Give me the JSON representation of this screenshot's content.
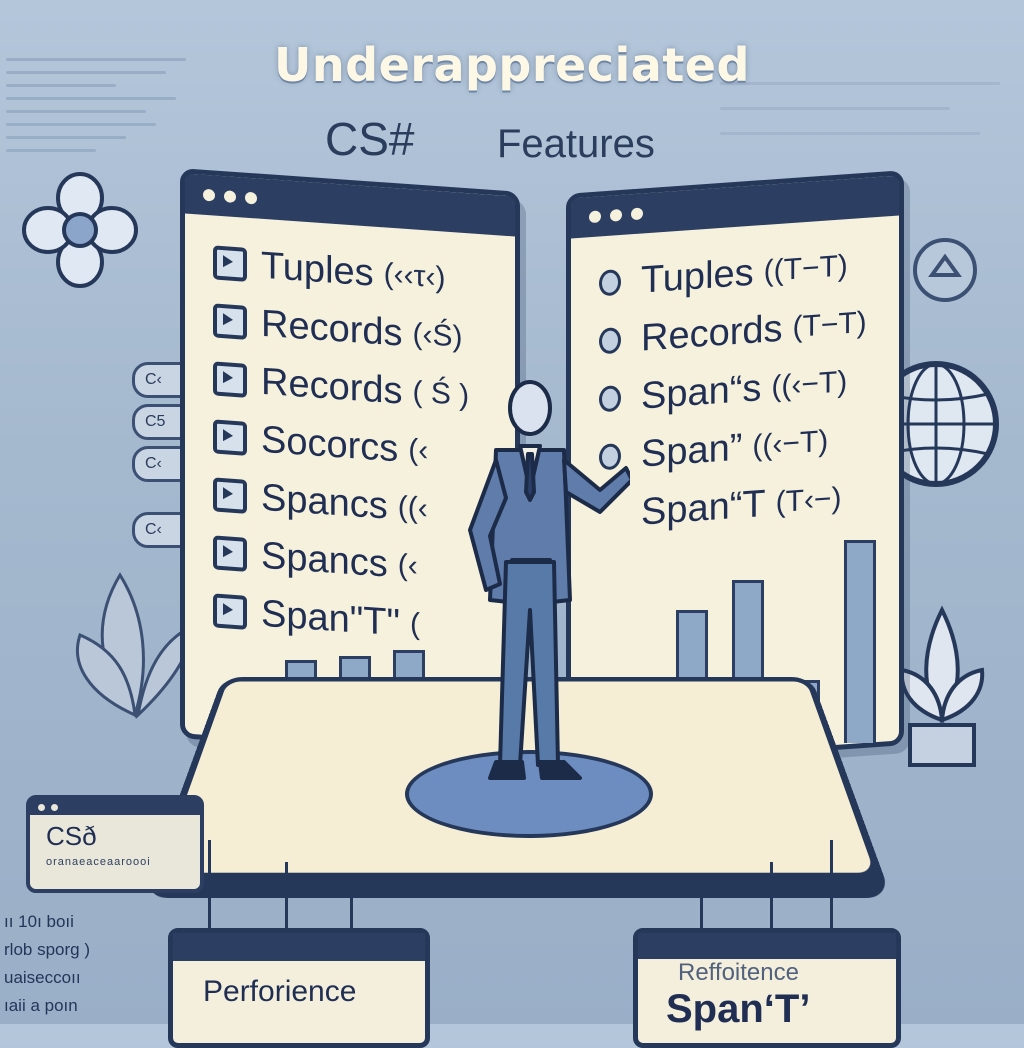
{
  "title": "Underappreciated",
  "subtitle": {
    "left": "CS#",
    "right": "Features"
  },
  "left_window": {
    "items": [
      {
        "label": "Tuples",
        "suffix": "(‹‹τ‹)"
      },
      {
        "label": "Records",
        "suffix": "(‹Ś)"
      },
      {
        "label": "Records",
        "suffix": "( Ś )"
      },
      {
        "label": "Socorcs",
        "suffix": "(‹"
      },
      {
        "label": "Spancs",
        "suffix": "((‹"
      },
      {
        "label": "Spancs",
        "suffix": "(‹"
      },
      {
        "label": "Span\"T\"",
        "suffix": "("
      }
    ]
  },
  "right_window": {
    "items": [
      {
        "label": "Tuples",
        "suffix": "((T−T)"
      },
      {
        "label": "Records",
        "suffix": "(T−T)"
      },
      {
        "label": "Span“s",
        "suffix": "((‹−T)"
      },
      {
        "label": "Span”",
        "suffix": "((‹−T)"
      },
      {
        "label": "Span“T",
        "suffix": "(T‹−)"
      }
    ]
  },
  "side_pills": [
    "C‹",
    "C5",
    "C‹",
    "C‹"
  ],
  "cards": {
    "cs": {
      "title": "CSð",
      "subtext": "oranaeaceaaroooi"
    },
    "performance": "Perforience",
    "span": {
      "top": "Reffoitence",
      "main": "Span‘T’"
    }
  },
  "bottom_left_text": [
    "ıı 10ı boıi",
    "rlob sporg )",
    "uaiseccoıı",
    "ıaii a poın"
  ],
  "colors": {
    "background": "#a9bcd2",
    "navy": "#26385a",
    "cream": "#f6f1dc",
    "accent": "#6d8dc0"
  }
}
